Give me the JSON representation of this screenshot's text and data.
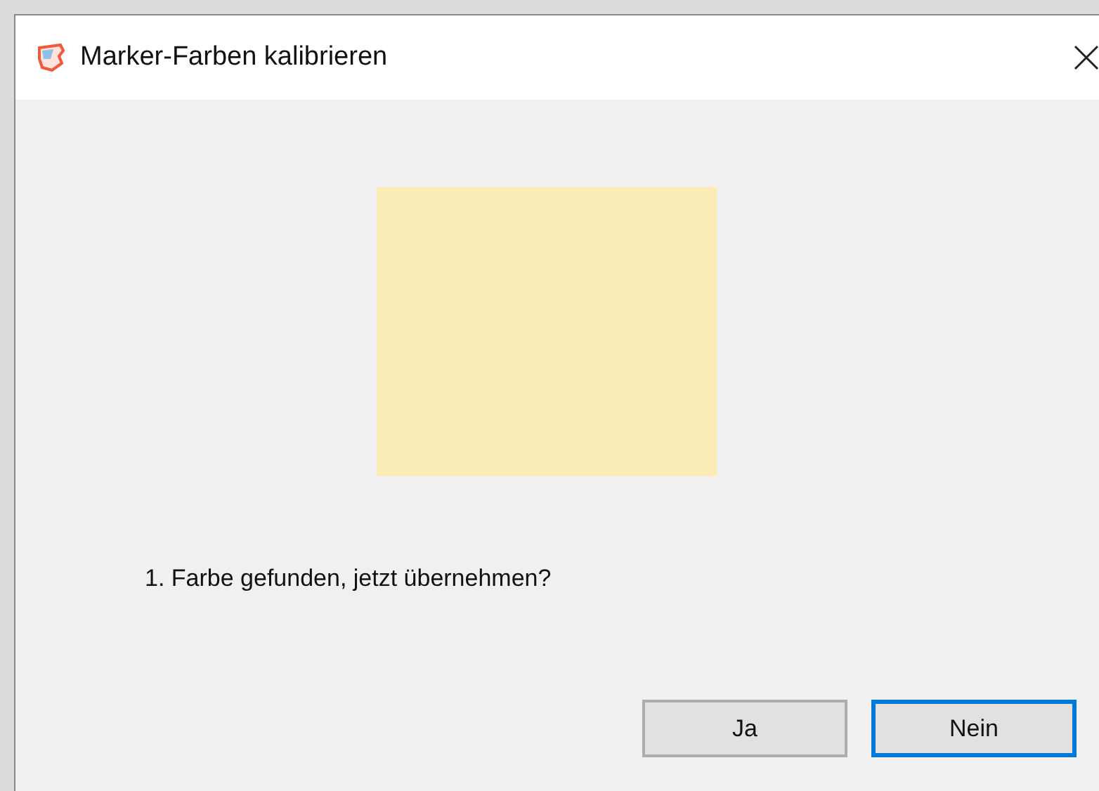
{
  "window": {
    "title": "Marker-Farben kalibrieren"
  },
  "swatch": {
    "color": "#fbebb6"
  },
  "message": "1. Farbe gefunden, jetzt übernehmen?",
  "buttons": [
    {
      "label": "Ja",
      "focused": false
    },
    {
      "label": "Nein",
      "focused": true
    }
  ]
}
